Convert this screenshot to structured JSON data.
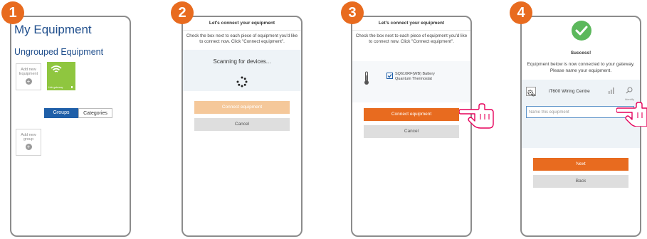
{
  "steps": [
    "1",
    "2",
    "3",
    "4"
  ],
  "panel1": {
    "title": "My Equipment",
    "subtitle": "Ungrouped Equipment",
    "add_equipment": "Add new Equipment",
    "device_caption": "Hub gateway",
    "groups_label": "Groups",
    "categories_label": "Categories",
    "add_group": "Add new group"
  },
  "panel2": {
    "header": "Let's connect your equipment",
    "intro": "Check the box next to each piece of equipment you'd like to connect now. Click \"Connect equipment\".",
    "scanning": "Scanning for devices...",
    "connect_label": "Connect equipment",
    "cancel_label": "Cancel"
  },
  "panel3": {
    "header": "Let's connect your equipment",
    "intro": "Check the box next to each piece of equipment you'd like to connect now. Click \"Connect equipment\".",
    "device_name": "SQ610RF(WB) Battery Quantum Thermostat",
    "checked": true,
    "connect_label": "Connect equipment",
    "cancel_label": "Cancel"
  },
  "panel4": {
    "success_title": "Success!",
    "success_text": "Equipment below is now connected to your gateway. Please name your equipment.",
    "device_name": "iT600 Wiring Centre",
    "identify_label": "Identify",
    "name_placeholder": "Name this equipment",
    "next_label": "Next",
    "back_label": "Back"
  },
  "colors": {
    "accent": "#e86b1f",
    "primary_blue": "#1f5fa8",
    "success_green": "#5cb85c",
    "device_green": "#8fc63f"
  },
  "icons": [
    "wifi-icon",
    "plus-icon",
    "spinner-icon",
    "thermometer-icon",
    "check-icon",
    "hand-pointer-icon",
    "gear-icon",
    "signal-icon",
    "search-icon"
  ]
}
